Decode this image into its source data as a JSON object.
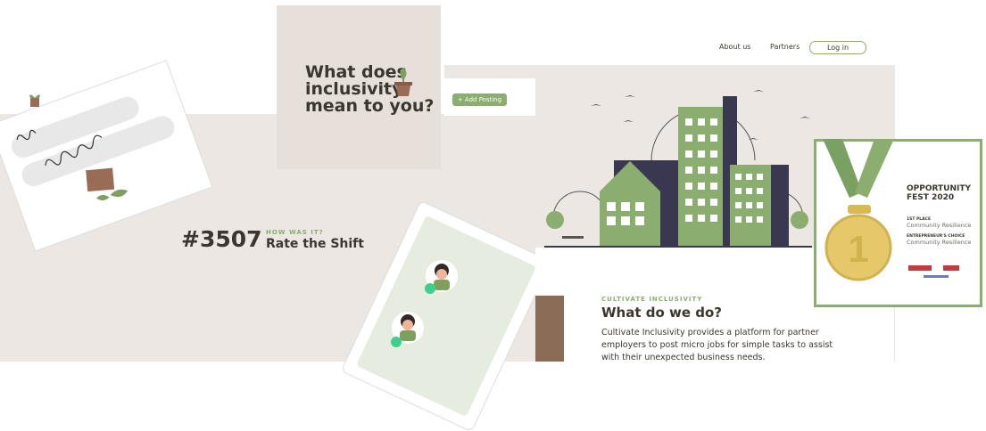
{
  "header": {
    "about": "About us",
    "partners": "Partners",
    "login": "Log in"
  },
  "quote": {
    "line1": "What does",
    "line2": "inclusivity",
    "line3": "mean to you?"
  },
  "posting": {
    "add_label": "+ Add Posting"
  },
  "shift": {
    "number": "#3507",
    "how_label": "HOW WAS IT?",
    "rate_label": "Rate the Shift"
  },
  "cultivate": {
    "label": "CULTIVATE INCLUSIVITY",
    "title": "What do we do?",
    "body": "Cultivate Inclusivity provides a platform for partner employers to post micro jobs for simple tasks to assist with their unexpected business needs."
  },
  "award": {
    "title": "OPPORTUNITY FEST 2020",
    "first_place": "1ST PLACE",
    "first_place_sub": "Community Resilience",
    "choice": "ENTREPRENEUR'S CHOICE",
    "choice_sub": "Community Resilience",
    "medal_number": "1"
  },
  "colors": {
    "accent_green": "#8bad70",
    "dark_text": "#3b372f",
    "beige": "#ece7e3",
    "building_dark": "#3a3850",
    "medal_gold": "#e4c86a"
  }
}
